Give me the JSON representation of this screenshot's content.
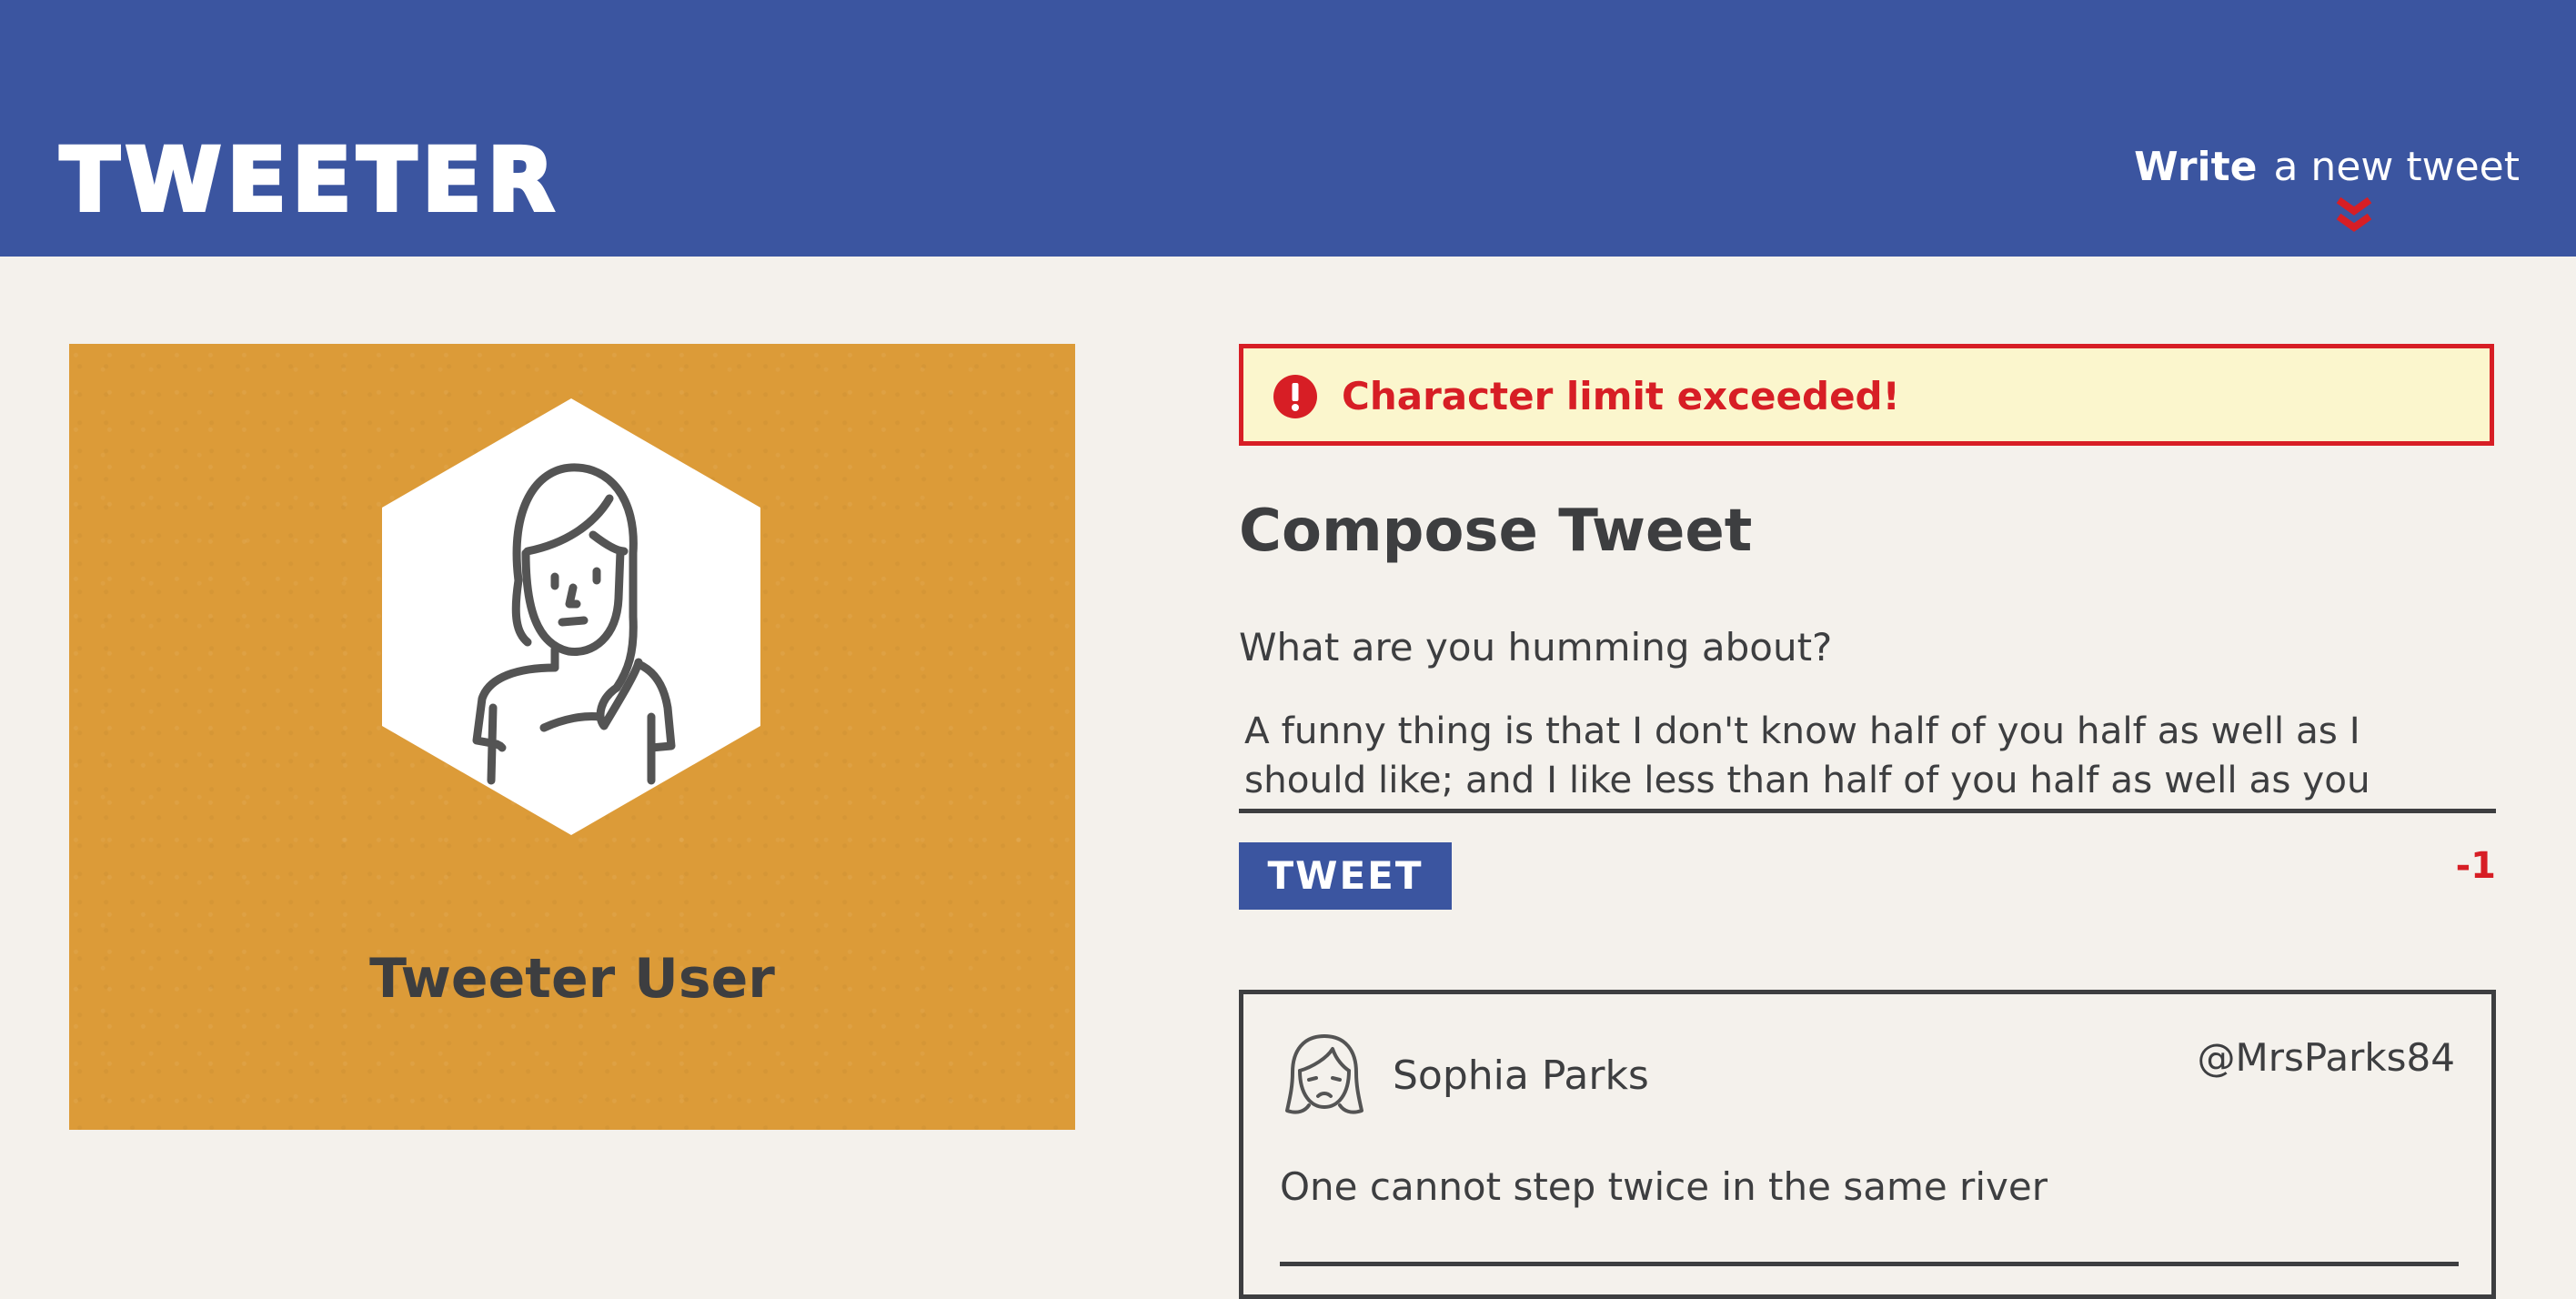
{
  "header": {
    "brand": "TWEETER",
    "write_bold": "Write",
    "write_rest": "a new tweet",
    "toggle_icon": "chevron-double-down-icon",
    "background_color": "#3b55a0",
    "arrow_color": "#d71e25"
  },
  "profile": {
    "name": "Tweeter User",
    "avatar_icon": "woman-avatar-icon",
    "card_color": "#dc9b38"
  },
  "compose": {
    "error_message": "Character limit exceeded!",
    "error_icon": "exclamation-circle-icon",
    "title": "Compose Tweet",
    "prompt_label": "What are you humming about?",
    "textarea_value": "A funny thing is that I don't know half of you half as well as I should like; and I like less than half of you half as well as you deserve...",
    "tweet_button_label": "TWEET",
    "char_counter": "-1",
    "error_color": "#d71e25",
    "error_background": "#fbf6cd"
  },
  "tweets": [
    {
      "name": "Sophia Parks",
      "handle": "@MrsParks84",
      "content": "One cannot step twice in the same river",
      "avatar_icon": "sad-woman-avatar-icon"
    }
  ]
}
